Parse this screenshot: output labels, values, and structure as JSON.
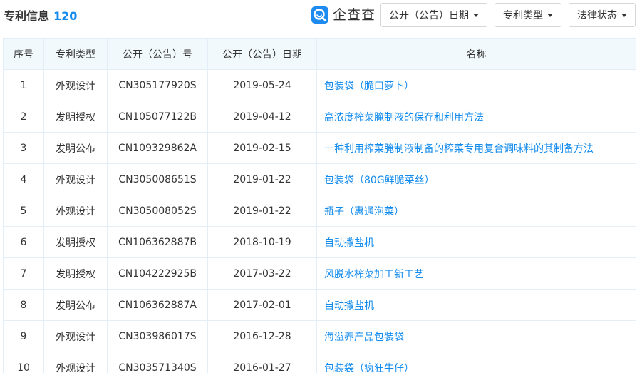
{
  "header": {
    "title": "专利信息",
    "count": "120",
    "brand": "企查查",
    "brand_icon": "qichacha-logo-icon"
  },
  "filters": {
    "date_label": "公开（公告）日期",
    "type_label": "专利类型",
    "status_label": "法律状态"
  },
  "colors": {
    "accent": "#128bed",
    "header_bg": "#f2f9fc",
    "border": "#e4eef6"
  },
  "table": {
    "columns": [
      "序号",
      "专利类型",
      "公开（公告）号",
      "公开（公告）日期",
      "名称"
    ],
    "rows": [
      {
        "index": "1",
        "type": "外观设计",
        "number": "CN305177920S",
        "date": "2019-05-24",
        "name": "包装袋（脆口萝卜）"
      },
      {
        "index": "2",
        "type": "发明授权",
        "number": "CN105077122B",
        "date": "2019-04-12",
        "name": "高浓度榨菜腌制液的保存和利用方法"
      },
      {
        "index": "3",
        "type": "发明公布",
        "number": "CN109329862A",
        "date": "2019-02-15",
        "name": "一种利用榨菜腌制液制备的榨菜专用复合调味料的其制备方法"
      },
      {
        "index": "4",
        "type": "外观设计",
        "number": "CN305008651S",
        "date": "2019-01-22",
        "name": "包装袋（80G鲜脆菜丝）"
      },
      {
        "index": "5",
        "type": "外观设计",
        "number": "CN305008052S",
        "date": "2019-01-22",
        "name": "瓶子（惠通泡菜）"
      },
      {
        "index": "6",
        "type": "发明授权",
        "number": "CN106362887B",
        "date": "2018-10-19",
        "name": "自动撒盐机"
      },
      {
        "index": "7",
        "type": "发明授权",
        "number": "CN104222925B",
        "date": "2017-03-22",
        "name": "风脱水榨菜加工新工艺"
      },
      {
        "index": "8",
        "type": "发明公布",
        "number": "CN106362887A",
        "date": "2017-02-01",
        "name": "自动撒盐机"
      },
      {
        "index": "9",
        "type": "外观设计",
        "number": "CN303986017S",
        "date": "2016-12-28",
        "name": "海溢养产品包装袋"
      },
      {
        "index": "10",
        "type": "外观设计",
        "number": "CN303571340S",
        "date": "2016-01-27",
        "name": "包装袋（疯狂牛仔）"
      }
    ]
  }
}
